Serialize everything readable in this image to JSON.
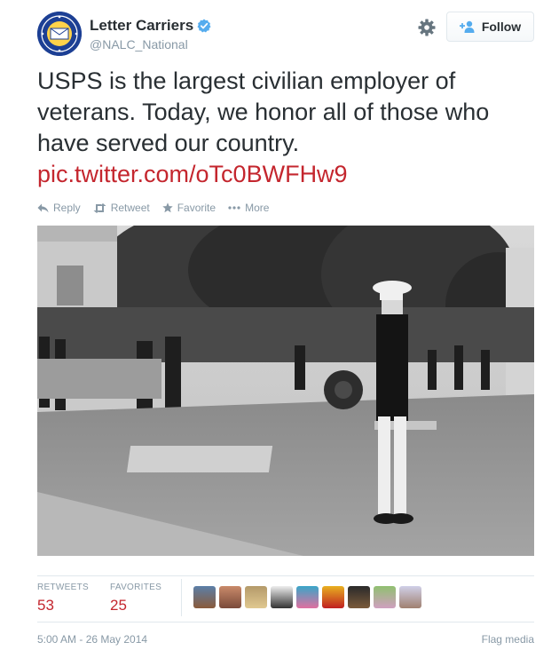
{
  "author": {
    "name": "Letter Carriers",
    "handle": "@NALC_National",
    "verified": true,
    "avatar_colors": {
      "ring": "#1c3f94",
      "center": "#ffd24a"
    }
  },
  "header": {
    "follow_label": "Follow"
  },
  "tweet": {
    "text": "USPS is the largest civilian employer of veterans. Today, we honor all of those who have served our country.",
    "link": "pic.twitter.com/oTc0BWFHw9"
  },
  "actions": {
    "reply": "Reply",
    "retweet": "Retweet",
    "favorite": "Favorite",
    "more": "More"
  },
  "stats": {
    "retweets_label": "RETWEETS",
    "retweets_value": "53",
    "favorites_label": "FAVORITES",
    "favorites_value": "25"
  },
  "footer": {
    "timestamp": "5:00 AM - 26 May 2014",
    "flag_label": "Flag media"
  },
  "colors": {
    "link": "#c4262e",
    "muted": "#8899a6",
    "text": "#292f33",
    "verified": "#55acee"
  }
}
